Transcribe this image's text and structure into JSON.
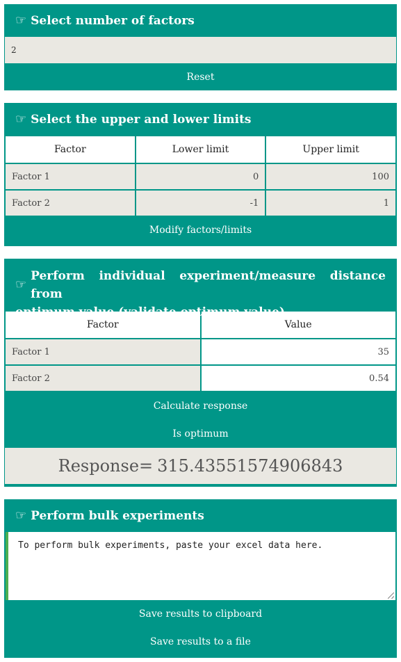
{
  "factors_panel": {
    "title": "Select number of factors",
    "value": "2",
    "reset_label": "Reset"
  },
  "limits_panel": {
    "title": "Select the upper and lower limits",
    "columns": [
      "Factor",
      "Lower limit",
      "Upper limit"
    ],
    "rows": [
      {
        "factor": "Factor 1",
        "lower": "0",
        "upper": "100"
      },
      {
        "factor": "Factor 2",
        "lower": "-1",
        "upper": "1"
      }
    ],
    "modify_label": "Modify factors/limits"
  },
  "experiment_panel": {
    "title_line1": "Perform individual experiment/measure distance from",
    "title_line2": "optimum value (validate optimum value)",
    "columns": [
      "Factor",
      "Value"
    ],
    "rows": [
      {
        "factor": "Factor 1",
        "value": "35"
      },
      {
        "factor": "Factor 2",
        "value": "0.54"
      }
    ],
    "calculate_label": "Calculate response",
    "optimum_label": "Is optimum",
    "response_label": "Response=",
    "response_value": "315.43551574906843"
  },
  "bulk_panel": {
    "title": "Perform bulk experiments",
    "placeholder": "To perform bulk experiments, paste your excel data here.",
    "clipboard_label": "Save results to clipboard",
    "file_label": "Save results to a file"
  },
  "icons": {
    "hand": "pointing-hand-icon"
  },
  "colors": {
    "panel": "#009688",
    "cell_grey": "#eae8e2",
    "accent_border": "#4caf50"
  }
}
